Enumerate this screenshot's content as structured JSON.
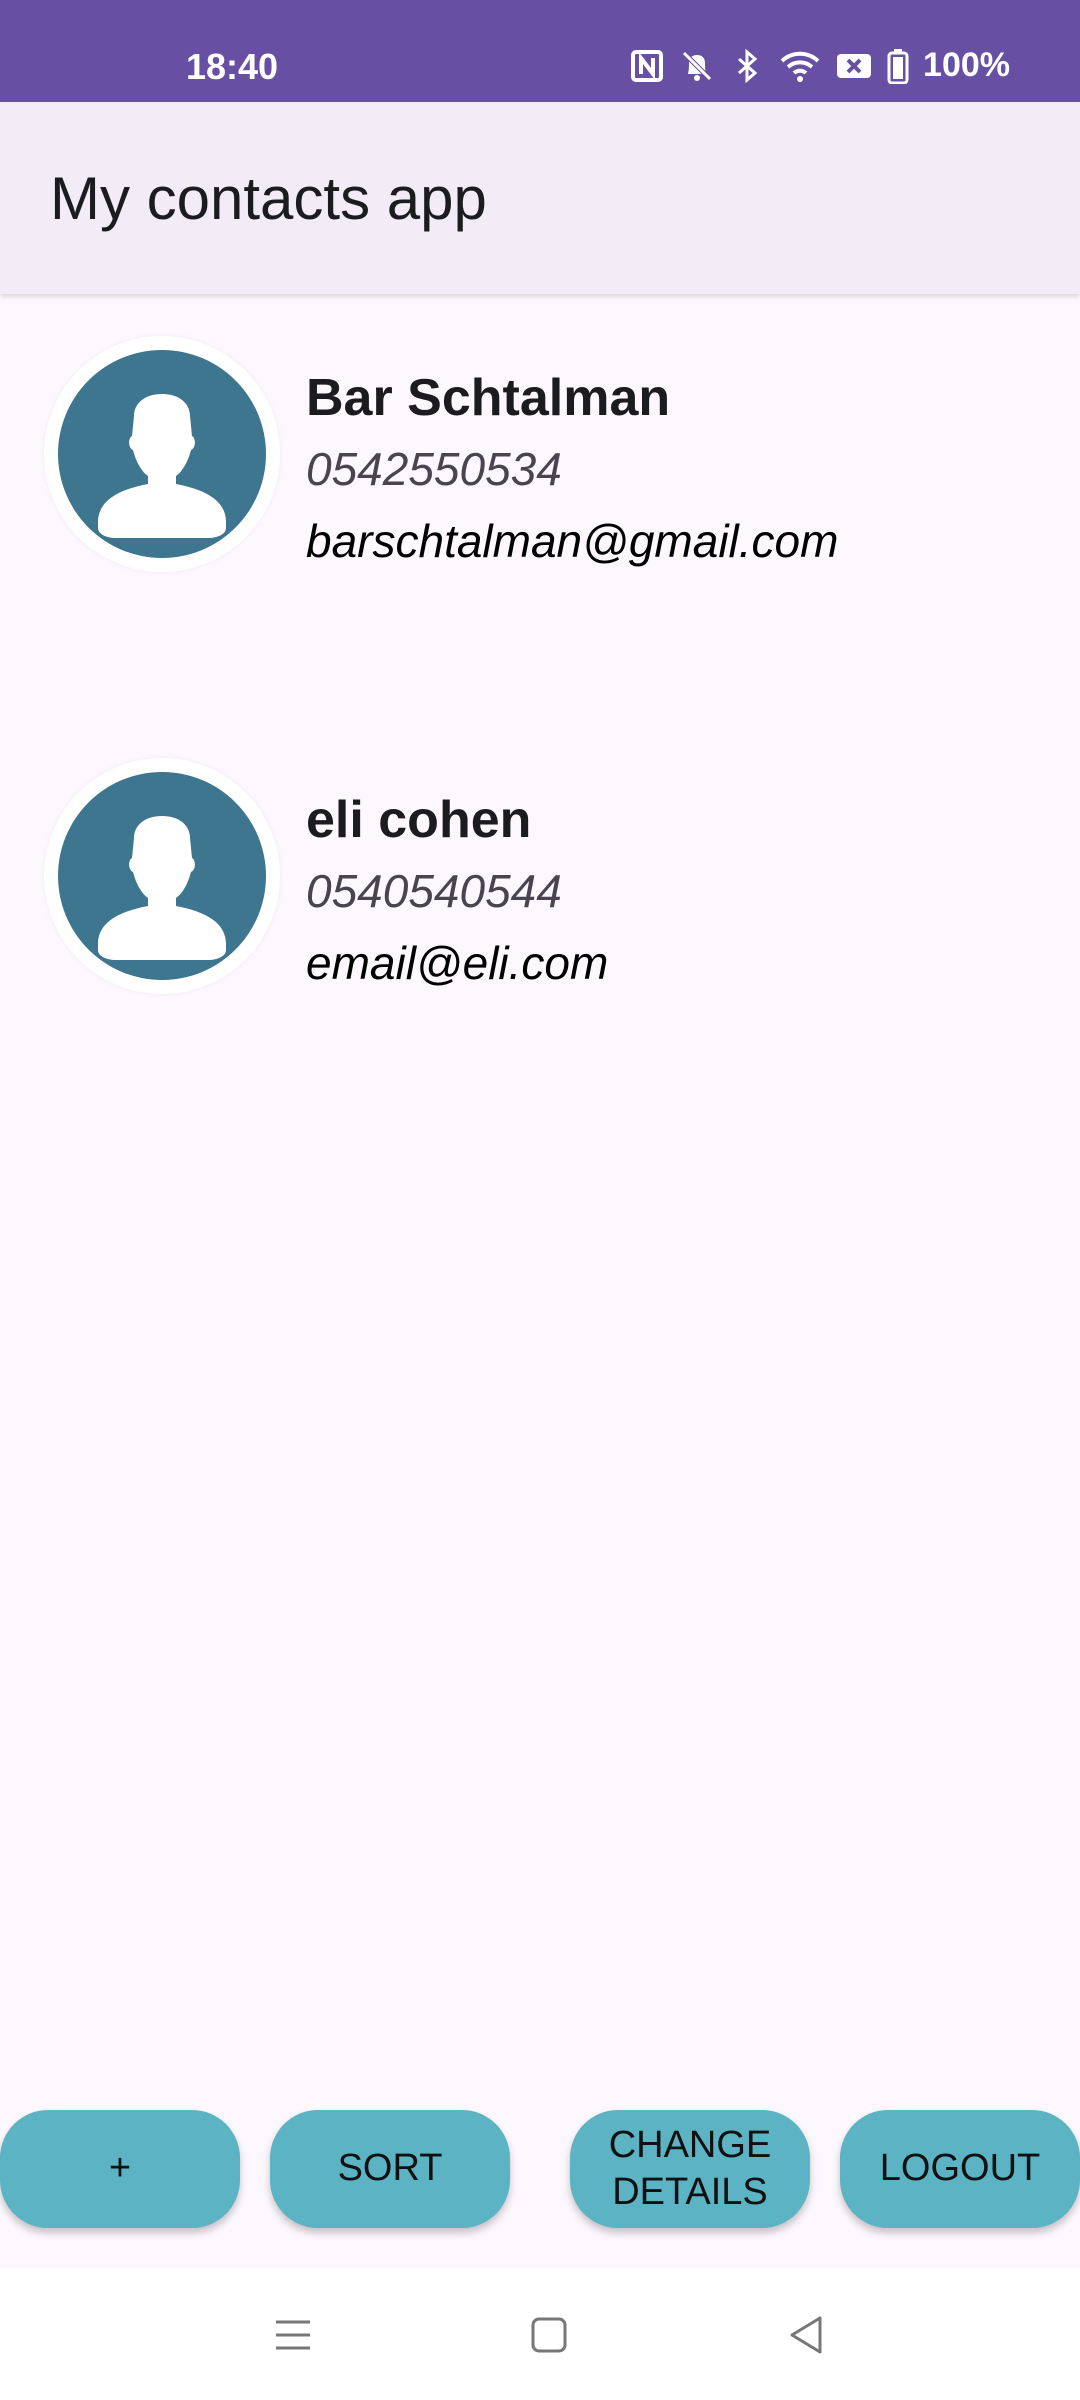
{
  "status_bar": {
    "time": "18:40",
    "battery": "100%",
    "icons": [
      "nfc-icon",
      "bell-off-icon",
      "bluetooth-icon",
      "wifi-icon",
      "sim-off-icon",
      "battery-icon"
    ]
  },
  "app_bar": {
    "title": "My contacts app"
  },
  "contacts": [
    {
      "name": "Bar Schtalman",
      "phone": "0542550534",
      "email": "barschtalman@gmail.com"
    },
    {
      "name": "eli cohen",
      "phone": "0540540544",
      "email": "email@eli.com"
    }
  ],
  "buttons": {
    "add": "+",
    "sort": "SORT",
    "change_details_line1": "CHANGE",
    "change_details_line2": "DETAILS",
    "logout": "LOGOUT"
  },
  "nav": [
    "menu-icon",
    "home-icon",
    "back-icon"
  ],
  "colors": {
    "status_bar": "#6750a4",
    "app_bar": "#f1ecf5",
    "background": "#fdf7fe",
    "avatar": "#3e7690",
    "button": "#5bb3c3"
  }
}
